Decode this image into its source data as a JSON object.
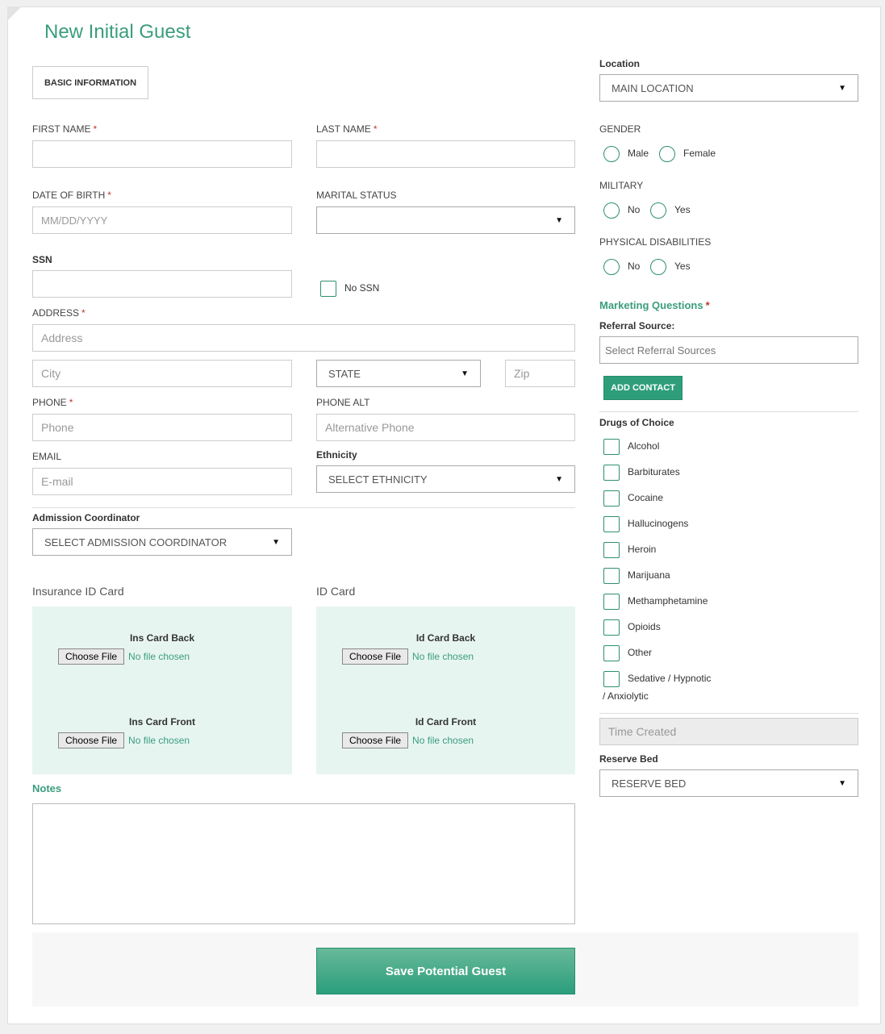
{
  "title": "New Initial Guest",
  "tab_label": "BASIC INFORMATION",
  "fields": {
    "first_name": "FIRST NAME",
    "last_name": "LAST NAME",
    "dob": "DATE OF BIRTH",
    "dob_placeholder": "MM/DD/YYYY",
    "marital": "MARITAL STATUS",
    "ssn": "SSN",
    "no_ssn": "No SSN",
    "address": "ADDRESS",
    "address_placeholder": "Address",
    "city_placeholder": "City",
    "state_value": "STATE",
    "zip_placeholder": "Zip",
    "phone": "PHONE",
    "phone_placeholder": "Phone",
    "phone_alt": "PHONE ALT",
    "phone_alt_placeholder": "Alternative Phone",
    "email": "EMAIL",
    "email_placeholder": "E-mail",
    "ethnicity": "Ethnicity",
    "ethnicity_value": "SELECT ETHNICITY",
    "admission": "Admission Coordinator",
    "admission_value": "SELECT ADMISSION COORDINATOR",
    "required_mark": "*"
  },
  "uploads": {
    "insurance_title": "Insurance ID Card",
    "id_title": "ID Card",
    "ins_back": "Ins Card Back",
    "ins_front": "Ins Card Front",
    "id_back": "Id Card Back",
    "id_front": "Id Card Front",
    "choose_file": "Choose File",
    "no_file": "No file chosen"
  },
  "notes_label": "Notes",
  "save_label": "Save Potential Guest",
  "right": {
    "location_label": "Location",
    "location_value": "MAIN LOCATION",
    "gender_label": "GENDER",
    "gender_options": [
      "Male",
      "Female"
    ],
    "military_label": "MILITARY",
    "military_options": [
      "No",
      "Yes"
    ],
    "physical_label": "PHYSICAL DISABILITIES",
    "physical_options": [
      "No",
      "Yes"
    ],
    "marketing_label": "Marketing Questions",
    "referral_label": "Referral Source:",
    "referral_placeholder": "Select Referral Sources",
    "add_contact": "ADD CONTACT",
    "drugs_label": "Drugs of Choice",
    "drugs": [
      "Alcohol",
      "Barbiturates",
      "Cocaine",
      "Hallucinogens",
      "Heroin",
      "Marijuana",
      "Methamphetamine",
      "Opioids",
      "Other",
      "Sedative / Hypnotic"
    ],
    "drugs_wrap": "/ Anxiolytic",
    "time_created_placeholder": "Time Created",
    "reserve_bed_label": "Reserve Bed",
    "reserve_bed_value": "RESERVE BED"
  },
  "colors": {
    "accent": "#3a9d7e",
    "required": "#c0392b",
    "upload_bg": "#e7f5f1"
  }
}
